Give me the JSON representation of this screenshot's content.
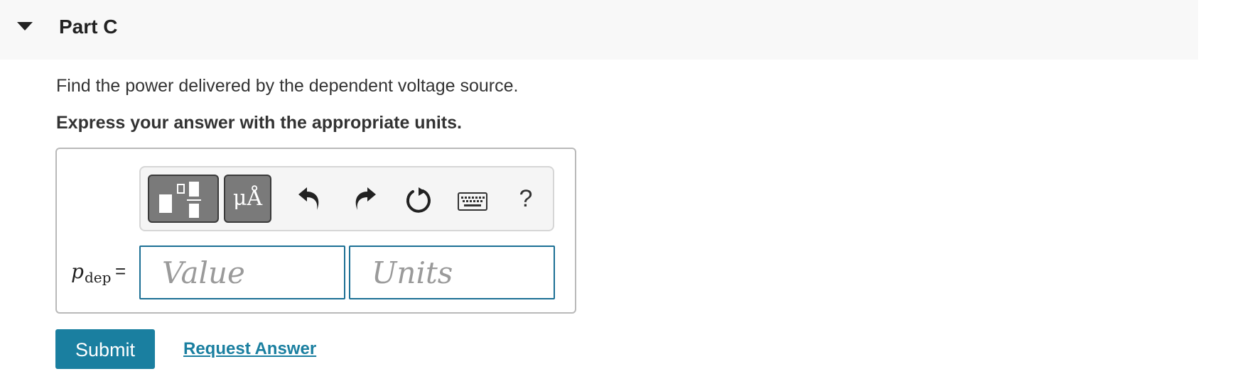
{
  "part": {
    "title": "Part C"
  },
  "question": {
    "text": "Find the power delivered by the dependent voltage source.",
    "instruction": "Express your answer with the appropriate units."
  },
  "toolbar": {
    "buttons": [
      {
        "name": "templates-icon"
      },
      {
        "name": "units-icon",
        "label": "μÅ"
      },
      {
        "name": "undo-icon"
      },
      {
        "name": "redo-icon"
      },
      {
        "name": "reset-icon"
      },
      {
        "name": "keyboard-icon"
      },
      {
        "name": "help-icon",
        "label": "?"
      }
    ]
  },
  "answer": {
    "variable": "p",
    "subscript": "dep",
    "equals": "=",
    "value_placeholder": "Value",
    "units_placeholder": "Units",
    "value": "",
    "units": ""
  },
  "actions": {
    "submit_label": "Submit",
    "request_label": "Request Answer"
  },
  "colors": {
    "accent": "#1a7fa0",
    "field_border": "#1b6f94",
    "header_bg": "#f8f8f8",
    "toolbar_button": "#7a7a7a"
  }
}
